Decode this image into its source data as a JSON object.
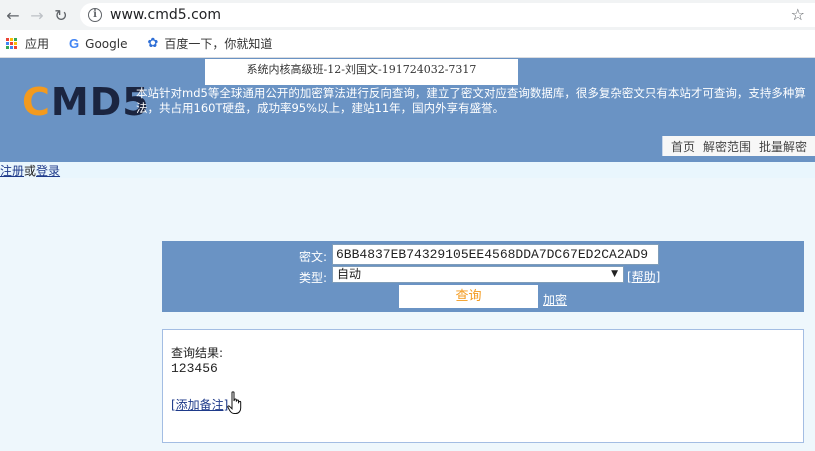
{
  "browser": {
    "url": "www.cmd5.com",
    "bookmarks": [
      {
        "label": "应用",
        "icon": "apps-grid-icon"
      },
      {
        "label": "Google",
        "icon": "google-g-icon"
      },
      {
        "label": "百度一下，你就知道",
        "icon": "baidu-paw-icon"
      }
    ]
  },
  "header": {
    "logo_c": "C",
    "logo_rest": "MD5",
    "intro": "本站针对md5等全球通用公开的加密算法进行反向查询，建立了密文对应查询数据库，很多复杂密文只有本站才可查询，支持多种算法，共占用160T硬盘，成功率95%以上，建站11年，国内外享有盛誉。",
    "watermark": "系统内核高级班-12-刘国文-191724032-7317",
    "nav": [
      "首页",
      "解密范围",
      "批量解密"
    ]
  },
  "auth": {
    "register": "注册",
    "or": "或",
    "login": "登录"
  },
  "query": {
    "cipher_label": "密文:",
    "cipher_value": "6BB4837EB74329105EE4568DDA7DC67ED2CA2AD9",
    "type_label": "类型:",
    "type_value": "自动",
    "help": "[帮助]",
    "submit": "查询",
    "encrypt": "加密"
  },
  "result": {
    "label": "查询结果:",
    "value": "123456",
    "add_note": "[添加备注]"
  },
  "colors": {
    "header_bg": "#6a93c4",
    "accent_orange": "#f39a1e",
    "page_bg": "#eef7fc"
  }
}
